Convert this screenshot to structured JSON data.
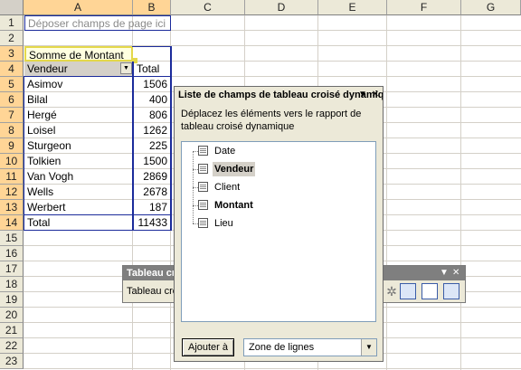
{
  "columns": [
    "A",
    "B",
    "C",
    "D",
    "E",
    "F",
    "G"
  ],
  "rows": [
    "1",
    "2",
    "3",
    "4",
    "5",
    "6",
    "7",
    "8",
    "9",
    "10",
    "11",
    "12",
    "13",
    "14",
    "15",
    "16",
    "17",
    "18",
    "19",
    "20",
    "21",
    "22",
    "23"
  ],
  "cells": {
    "a1": "Déposer champs de page ici",
    "a3": "Somme de Montant",
    "a4": "Vendeur",
    "b4": "Total",
    "sellers": [
      "Asimov",
      "Bilal",
      "Hergé",
      "Loisel",
      "Sturgeon",
      "Tolkien",
      "Van Vogh",
      "Wells",
      "Werbert"
    ],
    "amounts": [
      "1506",
      "400",
      "806",
      "1262",
      "225",
      "1500",
      "2869",
      "2678",
      "187"
    ],
    "total_label": "Total",
    "total_value": "11433"
  },
  "field_list": {
    "title": "Liste de champs de tableau croisé dynamique",
    "description": "Déplacez les éléments vers le rapport de tableau croisé dynamique",
    "fields": [
      {
        "label": "Date",
        "bold": false,
        "highlight": false
      },
      {
        "label": "Vendeur",
        "bold": true,
        "highlight": true
      },
      {
        "label": "Client",
        "bold": false,
        "highlight": false
      },
      {
        "label": "Montant",
        "bold": true,
        "highlight": false
      },
      {
        "label": "Lieu",
        "bold": false,
        "highlight": false
      }
    ],
    "add_button": "Ajouter à",
    "target_area": "Zone de lignes"
  },
  "pivot_toolbar": {
    "title": "Tableau croisé dynamique",
    "menu_label": "Tableau croisé dynamique"
  },
  "colors": {
    "pivot_border": "#1b2b9b",
    "header_selected": "#ffd596",
    "header_bg": "#ece9d8"
  }
}
